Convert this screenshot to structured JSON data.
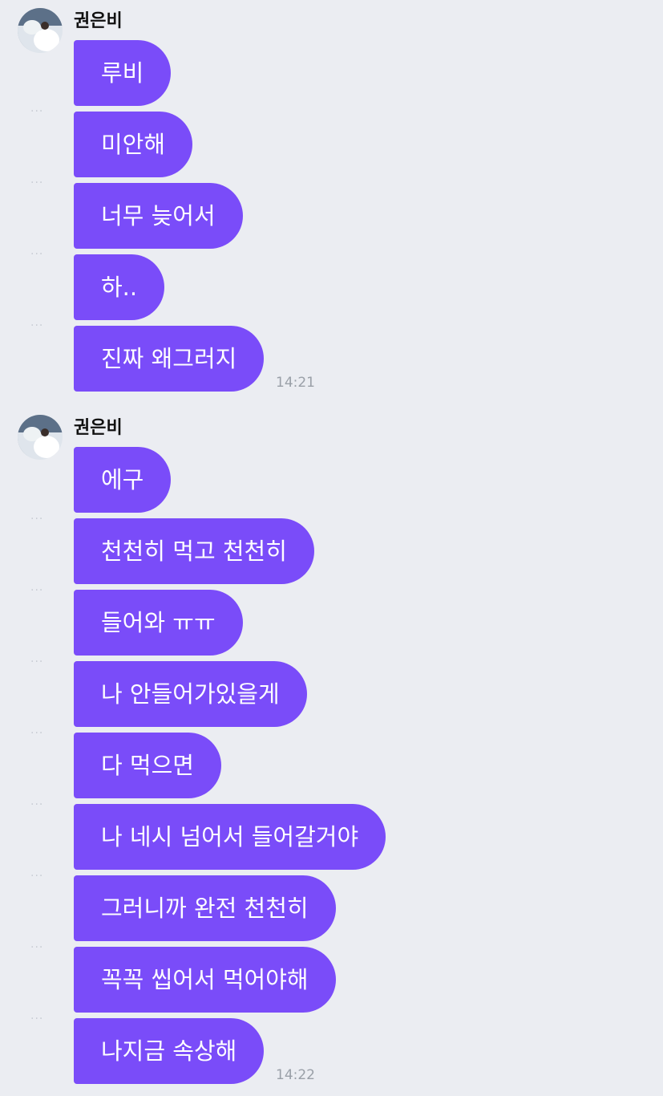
{
  "groups": [
    {
      "sender": "권은비",
      "messages": [
        "루비",
        "미안해",
        "너무 늦어서",
        "하..",
        "진짜 왜그러지"
      ],
      "time": "14:21"
    },
    {
      "sender": "권은비",
      "messages": [
        "에구",
        "천천히 먹고 천천히",
        "들어와 ㅠㅠ",
        "나 안들어가있을게",
        "다 먹으면",
        "나 네시 넘어서 들어갈거야",
        "그러니까 완전 천천히",
        "꼭꼭 씹어서 먹어야해",
        "나지금 속상해"
      ],
      "time": "14:22"
    }
  ],
  "dots_text": "···",
  "colors": {
    "background": "#ebedf2",
    "bubble": "#7a4cf9",
    "bubble_text": "#ffffff",
    "time_text": "#9aa0a8"
  }
}
